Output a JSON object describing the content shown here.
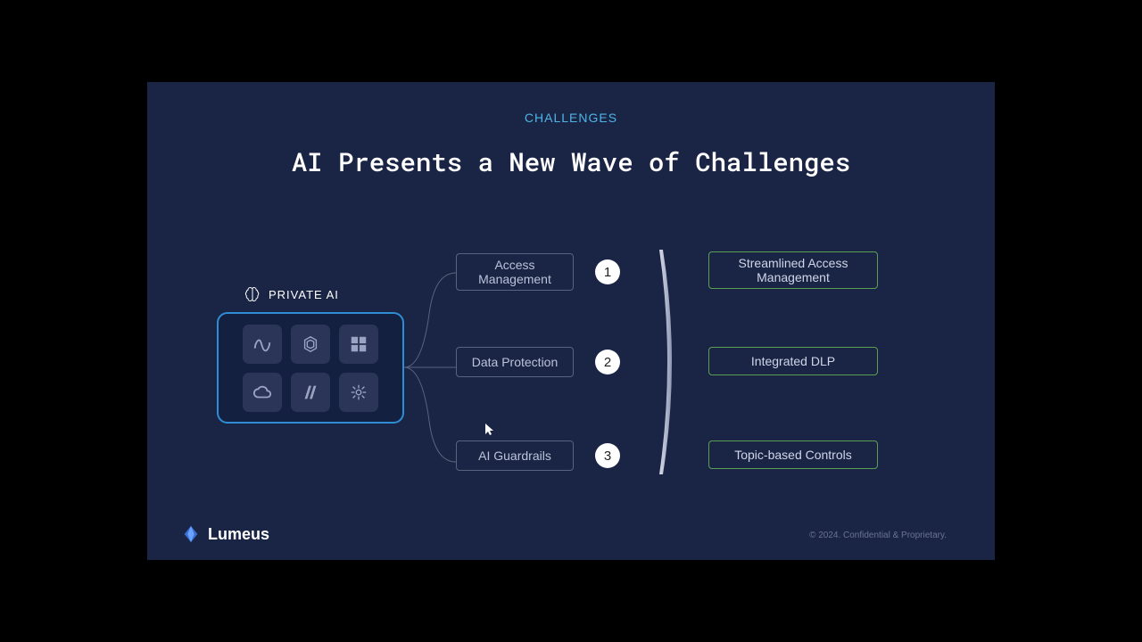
{
  "eyebrow": "CHALLENGES",
  "title": "AI Presents a New Wave of Challenges",
  "private_ai_label": "PRIVATE AI",
  "ai_tiles": [
    {
      "name": "meta-icon"
    },
    {
      "name": "openai-icon"
    },
    {
      "name": "microsoft-icon"
    },
    {
      "name": "google-cloud-icon"
    },
    {
      "name": "anthropic-icon"
    },
    {
      "name": "mistral-icon"
    }
  ],
  "challenges": [
    {
      "label": "Access Management",
      "num": "1"
    },
    {
      "label": "Data Protection",
      "num": "2"
    },
    {
      "label": "AI Guardrails",
      "num": "3"
    }
  ],
  "solutions": [
    {
      "label": "Streamlined Access Management"
    },
    {
      "label": "Integrated DLP"
    },
    {
      "label": "Topic-based Controls"
    }
  ],
  "footer": {
    "brand": "Lumeus",
    "copyright": "© 2024. Confidential & Proprietary."
  },
  "colors": {
    "slide_bg": "#1a2545",
    "eyebrow": "#4fb3e6",
    "ai_box_border": "#2f8dd4",
    "challenge_border": "#58637f",
    "solution_border": "#5b9e52"
  }
}
